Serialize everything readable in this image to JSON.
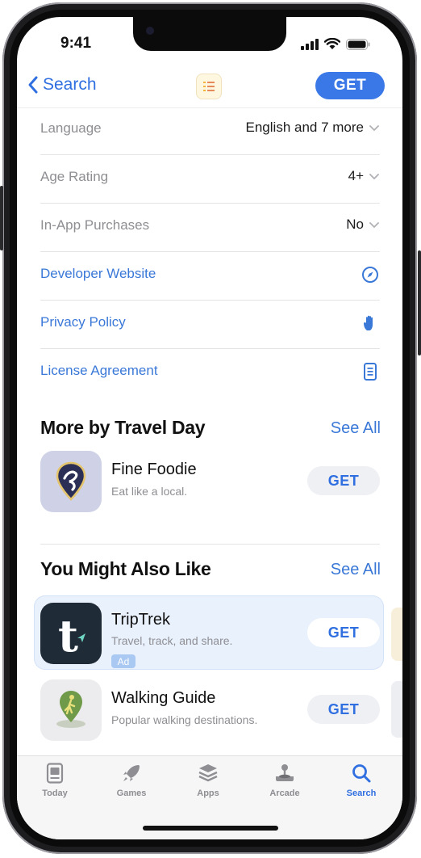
{
  "status_bar": {
    "time": "9:41"
  },
  "nav": {
    "back_label": "Search",
    "get_label": "GET"
  },
  "info_rows": [
    {
      "label": "Language",
      "value": "English and 7 more"
    },
    {
      "label": "Age Rating",
      "value": "4+"
    },
    {
      "label": "In-App Purchases",
      "value": "No"
    }
  ],
  "link_rows": [
    {
      "label": "Developer Website",
      "icon": "compass-icon"
    },
    {
      "label": "Privacy Policy",
      "icon": "hand-icon"
    },
    {
      "label": "License Agreement",
      "icon": "document-icon"
    }
  ],
  "more_by": {
    "title": "More by Travel Day",
    "see_all": "See All",
    "apps": [
      {
        "name": "Fine Foodie",
        "subtitle": "Eat like a local.",
        "get": "GET"
      }
    ]
  },
  "also_like": {
    "title": "You Might Also Like",
    "see_all": "See All",
    "apps": [
      {
        "name": "TripTrek",
        "subtitle": "Travel, track, and share.",
        "badge": "Ad",
        "get": "GET",
        "icon_letter": "t"
      },
      {
        "name": "Walking Guide",
        "subtitle": "Popular walking destinations.",
        "get": "GET"
      }
    ]
  },
  "tabs": [
    {
      "label": "Today",
      "icon": "today-icon",
      "active": false
    },
    {
      "label": "Games",
      "icon": "rocket-icon",
      "active": false
    },
    {
      "label": "Apps",
      "icon": "layers-icon",
      "active": false
    },
    {
      "label": "Arcade",
      "icon": "joystick-icon",
      "active": false
    },
    {
      "label": "Search",
      "icon": "search-icon",
      "active": true
    }
  ],
  "colors": {
    "accent": "#3b78e7",
    "link": "#3a78d8",
    "ad_background": "#e9f1fd"
  }
}
